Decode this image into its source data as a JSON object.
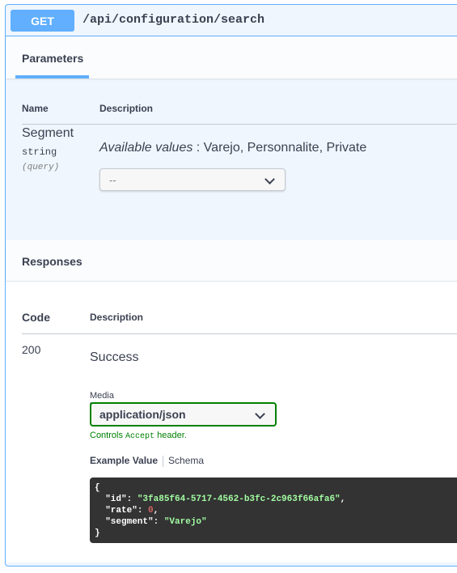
{
  "endpoint": {
    "method": "GET",
    "path": "/api/configuration/search"
  },
  "parameters": {
    "tab_label": "Parameters",
    "col_name": "Name",
    "col_description": "Description",
    "items": [
      {
        "name": "Segment",
        "type": "string",
        "in": "(query)",
        "available_prefix": "Available values",
        "available_values": " : Varejo, Personnalite, Private",
        "select_value": "--"
      }
    ]
  },
  "responses": {
    "title": "Responses",
    "col_code": "Code",
    "col_description": "Description",
    "items": [
      {
        "code": "200",
        "description": "Success",
        "media_type_label": "Media type",
        "media_type": "application/json",
        "controls_prefix": "Controls ",
        "controls_code": "Accept",
        "controls_suffix": " header.",
        "example_tab": "Example Value",
        "schema_tab": "Schema",
        "example": {
          "open": "{",
          "id_key": "\"id\"",
          "id_val": "\"3fa85f64-5717-4562-b3fc-2c963f66afa6\"",
          "rate_key": "\"rate\"",
          "rate_val": "0",
          "segment_key": "\"segment\"",
          "segment_val": "\"Varejo\"",
          "close": "}"
        }
      }
    ]
  },
  "colors": {
    "get_blue": "#61affe",
    "success_green": "#008000",
    "code_bg": "#333333"
  },
  "icons": {
    "select_chevron": "chevron-down-icon"
  }
}
